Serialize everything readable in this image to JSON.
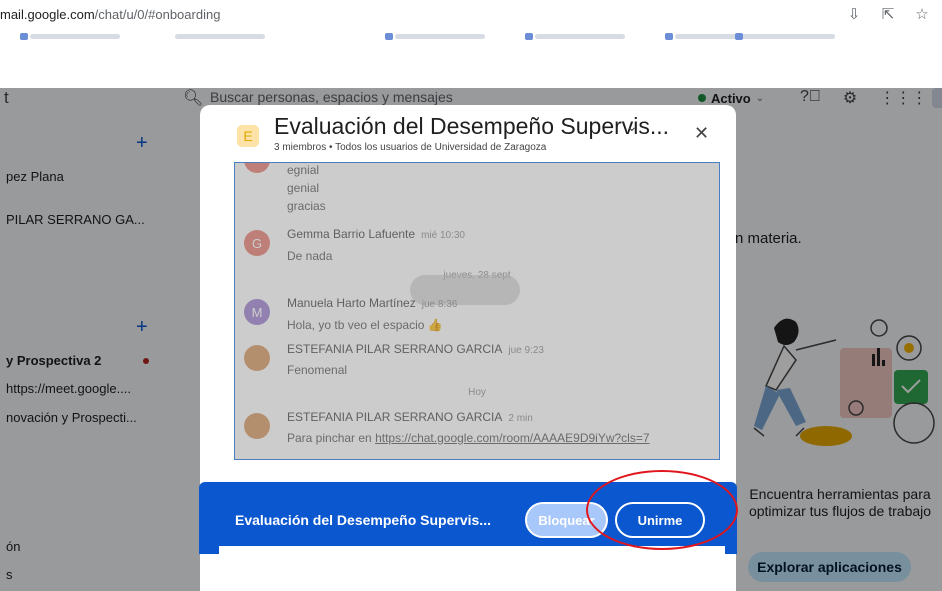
{
  "browser": {
    "url_host": "mail.google.com",
    "url_path": "/chat/u/0/#onboarding",
    "icons": [
      "install-icon",
      "share-icon",
      "star-icon"
    ]
  },
  "chat": {
    "title_fragment": "t",
    "search_placeholder": "Buscar personas, espacios y mensajes",
    "status": "Activo",
    "status_color": "#1e8e3e",
    "sidebar": [
      {
        "label": "pez Plana"
      },
      {
        "label": "PILAR SERRANO GA..."
      },
      {
        "label": "y Prospectiva 2"
      },
      {
        "label": "https://meet.google...."
      },
      {
        "label": "novación y Prospecti..."
      },
      {
        "label": "ón"
      },
      {
        "label": "s"
      }
    ],
    "right_text": "n materia.",
    "promo_text": "Encuentra herramientas para optimizar tus flujos de trabajo",
    "promo_button": "Explorar aplicaciones"
  },
  "dialog": {
    "icon_letter": "E",
    "title": "Evaluación del Desempeño Supervis...",
    "subtitle": "3 miembros • Todos los usuarios de Universidad de Zaragoza",
    "messages": {
      "m1": "egnial",
      "m2": "genial",
      "m3": "gracias",
      "sender1": "Gemma Barrio Lafuente",
      "time1": "mié 10:30",
      "avatar1": "G",
      "m4": "De nada",
      "date1": "jueves, 28 sept",
      "sender2": "Manuela Harto Martínez",
      "time2": "jue 8:36",
      "avatar2": "M",
      "m5": "Hola, yo tb veo el espacio 👍",
      "sender3": "ESTEFANIA PILAR SERRANO GARCIA",
      "time3": "jue 9:23",
      "m6": "Fenomenal",
      "date2": "Hoy",
      "sender4": "ESTEFANIA PILAR SERRANO GARCIA",
      "time4": "2 min",
      "m7_prefix": "Para pinchar en ",
      "m7_link": "https://chat.google.com/room/AAAAE9D9iYw?cls=7"
    }
  },
  "banner": {
    "title": "Evaluación del Desempeño Supervis...",
    "block_label": "Bloquear",
    "join_label": "Unirme"
  }
}
